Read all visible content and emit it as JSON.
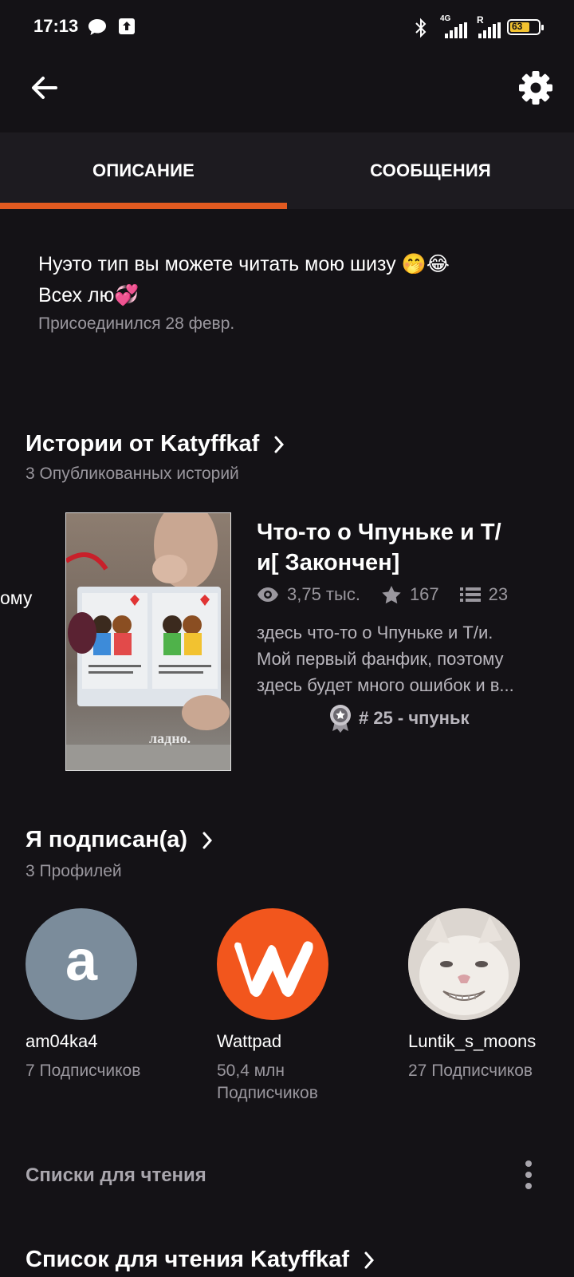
{
  "status_bar": {
    "time": "17:13",
    "battery": "63",
    "network": "4G",
    "roaming": "R",
    "icons": [
      "message-icon",
      "upload-icon",
      "bluetooth-icon",
      "signal-icon",
      "battery-icon"
    ]
  },
  "tabs": {
    "description": "ОПИСАНИЕ",
    "messages": "СООБЩЕНИЯ",
    "active": "description",
    "accent_color": "#e25a20"
  },
  "bio": {
    "line1": "Нуэто тип вы можете читать мою шизу 🤭😂",
    "line2": "Всех лю💞",
    "joined": "Присоединился 28 февр."
  },
  "stories": {
    "title": "Истории от Katyffkaf",
    "subtitle": "3 Опубликованных историй",
    "peek_text": "ому",
    "card": {
      "cover_caption": "ладно.",
      "title_line1": "Что-то о Чпуньке и Т/",
      "title_line2": "и[ Закончен]",
      "views": "3,75 тыс.",
      "votes": "167",
      "parts": "23",
      "description_lines": [
        "здесь что-то о Чпуньке и Т/и.",
        "Мой первый фанфик, поэтому",
        "здесь будет много ошибок и в..."
      ],
      "rank": "# 25 - чпуньк"
    }
  },
  "following": {
    "title": "Я подписан(а)",
    "subtitle": "3 Профилей",
    "profiles": [
      {
        "avatar_letter": "a",
        "name": "am04ka4",
        "followers_line1": "7 Подписчиков",
        "followers_line2": ""
      },
      {
        "avatar_letter": "w",
        "name": "Wattpad",
        "followers_line1": "50,4 млн",
        "followers_line2": "Подписчиков"
      },
      {
        "avatar_letter": "",
        "name": "Luntik_s_moons",
        "followers_line1": "27 Подписчиков",
        "followers_line2": ""
      }
    ]
  },
  "reading_lists": {
    "label": "Списки для чтения",
    "list_title": "Список для чтения Katyffkaf"
  }
}
